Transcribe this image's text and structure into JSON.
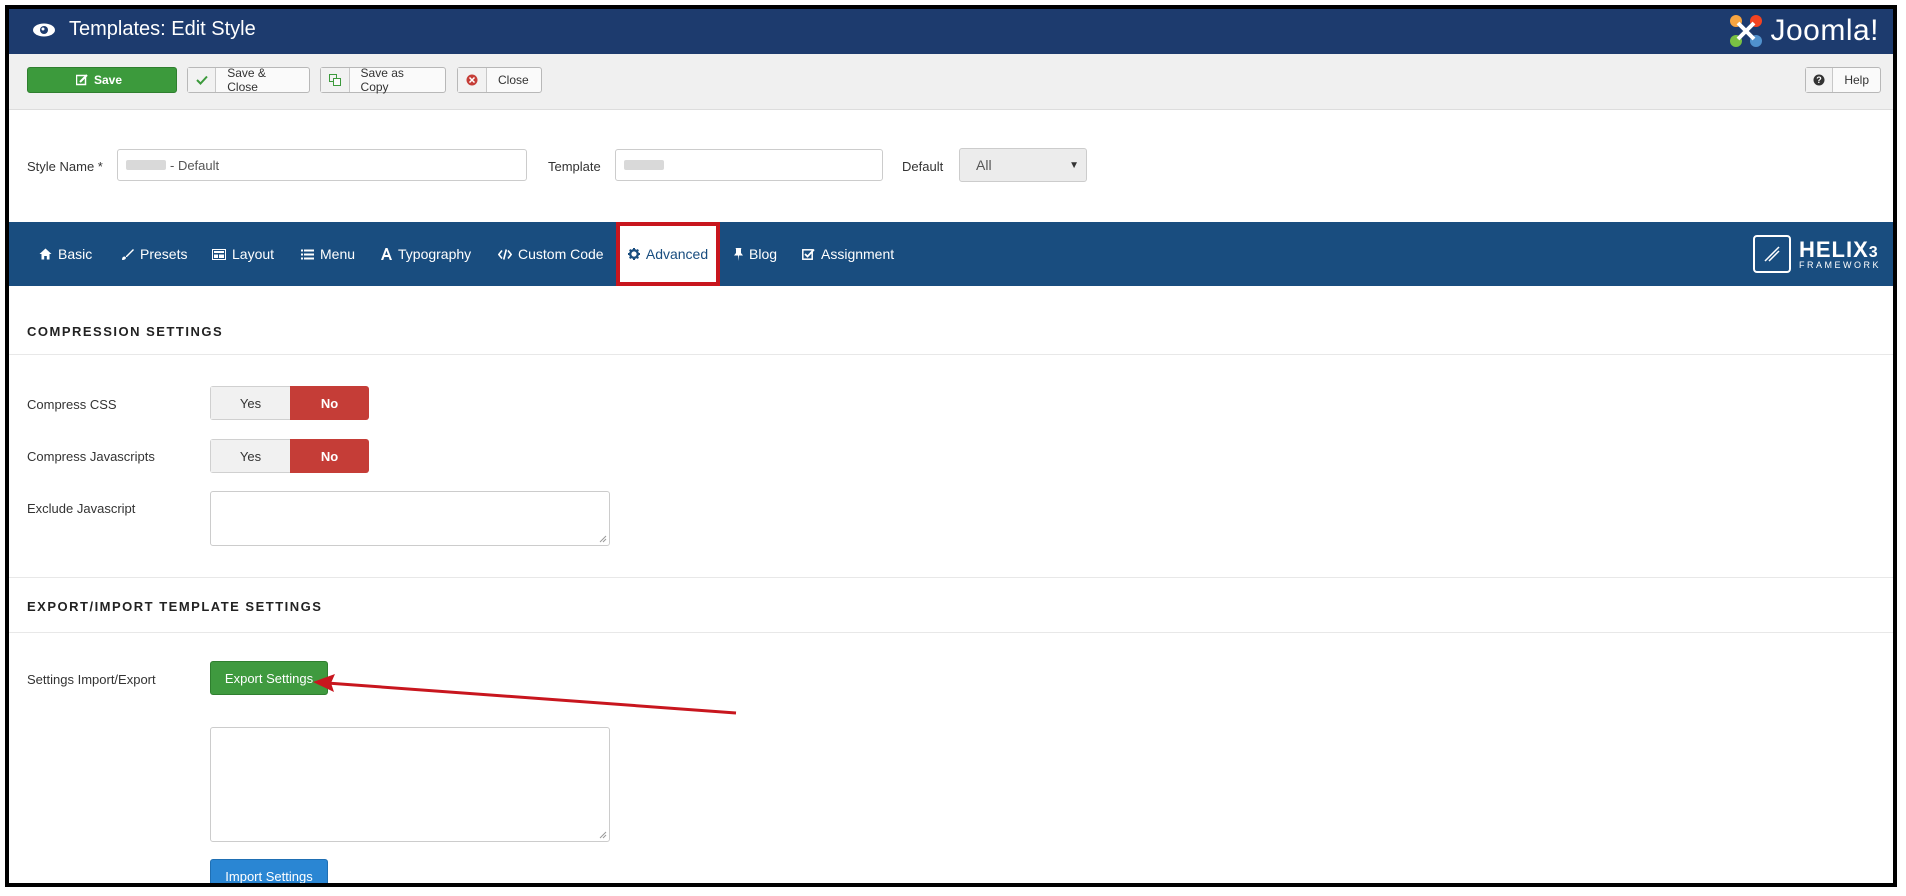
{
  "header": {
    "title": "Templates: Edit Style",
    "brand": "Joomla!"
  },
  "toolbar": {
    "save_label": "Save",
    "save_close_label": "Save & Close",
    "save_copy_label": "Save as Copy",
    "close_label": "Close",
    "help_label": "Help"
  },
  "style": {
    "style_name_label": "Style Name *",
    "style_name_value": "- Default",
    "template_label": "Template",
    "default_label": "Default",
    "default_value": "All"
  },
  "tabs": [
    {
      "label": "Basic",
      "icon": "home-icon"
    },
    {
      "label": "Presets",
      "icon": "brush-icon"
    },
    {
      "label": "Layout",
      "icon": "layout-icon"
    },
    {
      "label": "Menu",
      "icon": "list-icon"
    },
    {
      "label": "Typography",
      "icon": "font-icon"
    },
    {
      "label": "Custom Code",
      "icon": "code-icon"
    },
    {
      "label": "Advanced",
      "icon": "gear-icon",
      "active": true
    },
    {
      "label": "Blog",
      "icon": "pin-icon"
    },
    {
      "label": "Assignment",
      "icon": "check-square-icon"
    }
  ],
  "helix": {
    "name": "HELIX",
    "version": "3",
    "subtitle": "FRAMEWORK"
  },
  "compression": {
    "title": "COMPRESSION SETTINGS",
    "compress_css_label": "Compress CSS",
    "compress_js_label": "Compress Javascripts",
    "exclude_js_label": "Exclude Javascript",
    "yes_label": "Yes",
    "no_label": "No",
    "compress_css_value": "No",
    "compress_js_value": "No"
  },
  "export_import": {
    "title": "EXPORT/IMPORT TEMPLATE SETTINGS",
    "row_label": "Settings Import/Export",
    "export_label": "Export Settings",
    "import_label": "Import Settings"
  },
  "colors": {
    "header_bg": "#1d3b6e",
    "tabbar_bg": "#194d7f",
    "save_green": "#3c9a3c",
    "no_red": "#c53d37",
    "import_blue": "#2a86d3",
    "highlight_red": "#c8161e"
  }
}
